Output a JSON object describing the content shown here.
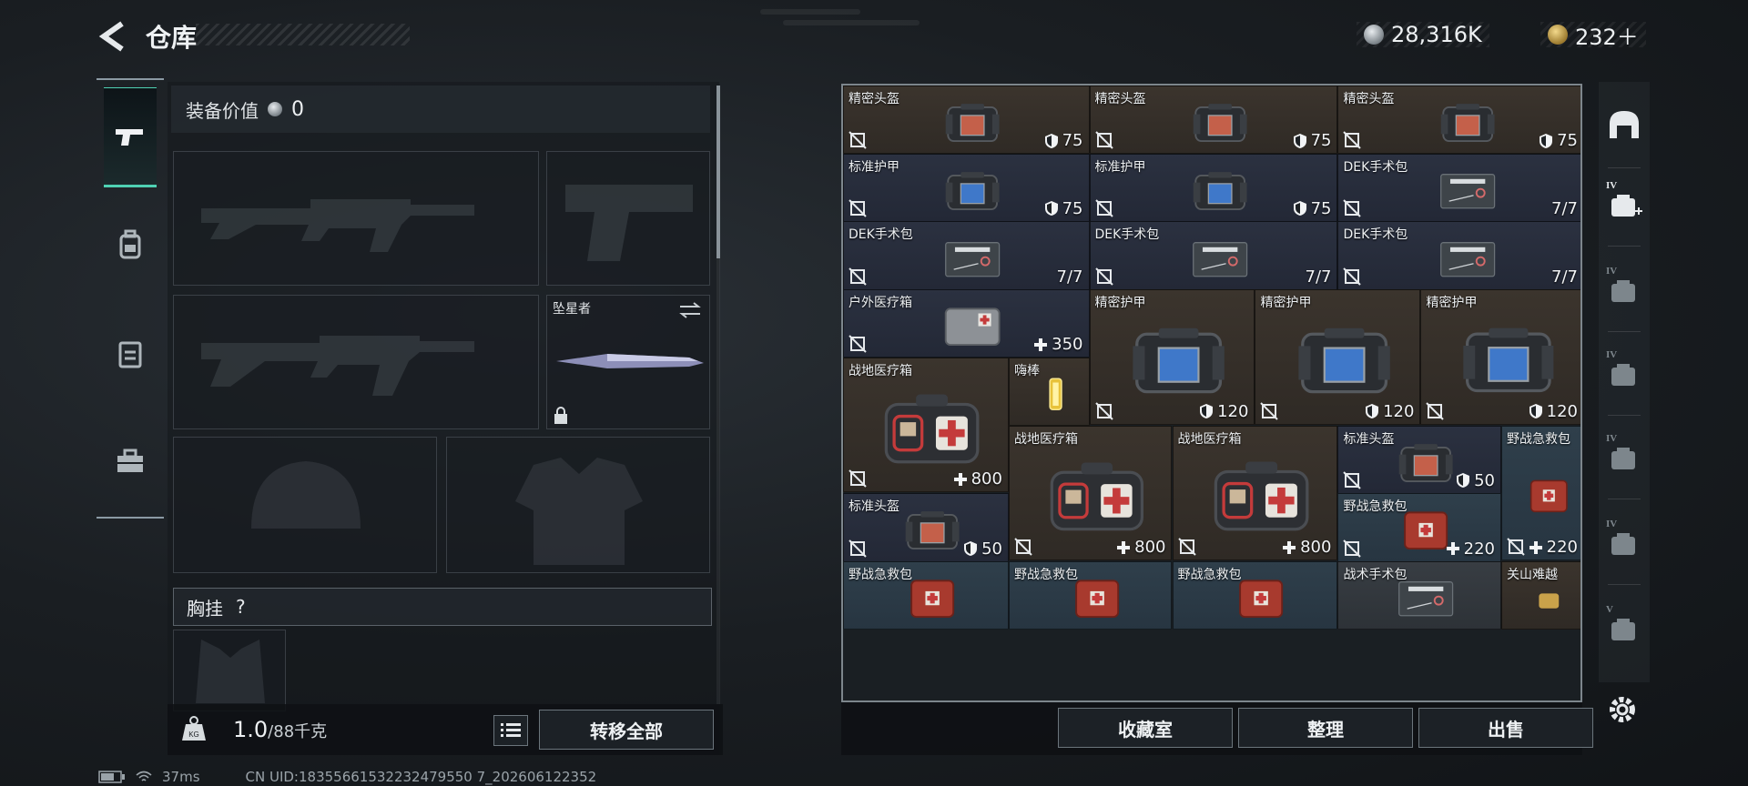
{
  "header": {
    "title": "仓库",
    "currency": [
      {
        "icon": "silver-coin-icon",
        "value": "28,316K"
      },
      {
        "icon": "gold-coin-icon",
        "value": "232＋"
      }
    ]
  },
  "left_tabs": [
    {
      "icon": "pistol-icon",
      "active": true
    },
    {
      "icon": "backpack-icon",
      "active": false
    },
    {
      "icon": "vest-icon",
      "active": false
    },
    {
      "icon": "toolbox-icon",
      "active": false
    }
  ],
  "equipment": {
    "value_label": "装备价值",
    "value": "0",
    "melee_name": "坠星者",
    "chest_rig_label": "胸挂",
    "chest_rig_help": "?"
  },
  "capacity": {
    "current": "1.0",
    "max": "/88千克"
  },
  "buttons": {
    "transfer_all": "转移全部",
    "collection": "收藏室",
    "sort": "整理",
    "sell": "出售"
  },
  "status": {
    "ping": "37ms",
    "uid": "CN UID:18355661532232479550 7_202606122352"
  },
  "storage": {
    "items": [
      {
        "name": "精密头盔",
        "stat": "75",
        "stat_icon": "shield",
        "bg": "brown",
        "kind": "helmet"
      },
      {
        "name": "精密头盔",
        "stat": "75",
        "stat_icon": "shield",
        "bg": "brown",
        "kind": "helmet"
      },
      {
        "name": "精密头盔",
        "stat": "75",
        "stat_icon": "shield",
        "bg": "brown",
        "kind": "helmet"
      },
      {
        "name": "标准护甲",
        "stat": "75",
        "stat_icon": "shield",
        "bg": "navy",
        "kind": "armor"
      },
      {
        "name": "标准护甲",
        "stat": "75",
        "stat_icon": "shield",
        "bg": "navy",
        "kind": "armor"
      },
      {
        "name": "DEK手术包",
        "stat": "7/7",
        "stat_icon": "",
        "bg": "navy",
        "kind": "surgkit"
      },
      {
        "name": "DEK手术包",
        "stat": "7/7",
        "stat_icon": "",
        "bg": "navy",
        "kind": "surgkit"
      },
      {
        "name": "DEK手术包",
        "stat": "7/7",
        "stat_icon": "",
        "bg": "navy",
        "kind": "surgkit"
      },
      {
        "name": "DEK手术包",
        "stat": "7/7",
        "stat_icon": "",
        "bg": "navy",
        "kind": "surgkit"
      },
      {
        "name": "户外医疗箱",
        "stat": "350",
        "stat_icon": "plus",
        "bg": "navy",
        "kind": "outdoorkit"
      },
      {
        "name": "精密护甲",
        "stat": "120",
        "stat_icon": "shield",
        "bg": "brown",
        "kind": "armor"
      },
      {
        "name": "精密护甲",
        "stat": "120",
        "stat_icon": "shield",
        "bg": "brown",
        "kind": "armor"
      },
      {
        "name": "精密护甲",
        "stat": "120",
        "stat_icon": "shield",
        "bg": "brown",
        "kind": "armor"
      },
      {
        "name": "战地医疗箱",
        "stat": "800",
        "stat_icon": "plus",
        "bg": "brown",
        "kind": "medkit"
      },
      {
        "name": "嗨棒",
        "stat": "",
        "stat_icon": "",
        "bg": "brown",
        "kind": "glowstick"
      },
      {
        "name": "战地医疗箱",
        "stat": "800",
        "stat_icon": "plus",
        "bg": "brown",
        "kind": "medkit"
      },
      {
        "name": "战地医疗箱",
        "stat": "800",
        "stat_icon": "plus",
        "bg": "brown",
        "kind": "medkit"
      },
      {
        "name": "标准头盔",
        "stat": "50",
        "stat_icon": "shield",
        "bg": "navy",
        "kind": "helmet"
      },
      {
        "name": "野战急救包",
        "stat": "220",
        "stat_icon": "plus",
        "bg": "teal",
        "kind": "firstaid-tall"
      },
      {
        "name": "标准头盔",
        "stat": "50",
        "stat_icon": "shield",
        "bg": "navy",
        "kind": "helmet"
      },
      {
        "name": "野战急救包",
        "stat": "220",
        "stat_icon": "plus",
        "bg": "teal",
        "kind": "firstaid"
      },
      {
        "name": "野战急救包",
        "stat": "",
        "stat_icon": "",
        "bg": "teal",
        "kind": "firstaid"
      },
      {
        "name": "野战急救包",
        "stat": "",
        "stat_icon": "",
        "bg": "teal",
        "kind": "firstaid"
      },
      {
        "name": "野战急救包",
        "stat": "",
        "stat_icon": "",
        "bg": "teal",
        "kind": "firstaid"
      },
      {
        "name": "战术手术包",
        "stat": "",
        "stat_icon": "",
        "bg": "gray",
        "kind": "surgkit"
      },
      {
        "name": "关山难越",
        "stat": "",
        "stat_icon": "",
        "bg": "brown",
        "kind": "misc"
      }
    ]
  },
  "right_tabs": [
    {
      "icon": "helmet-filter-icon",
      "tier": ""
    },
    {
      "icon": "medical-filter-icon",
      "tier": "IV"
    },
    {
      "icon": "weapon-filter-icon",
      "tier": "IV"
    },
    {
      "icon": "attachment-filter-icon",
      "tier": "IV"
    },
    {
      "icon": "armor-filter-icon",
      "tier": "IV"
    },
    {
      "icon": "ammo-filter-icon",
      "tier": "IV"
    },
    {
      "icon": "key-filter-icon",
      "tier": "V"
    }
  ]
}
